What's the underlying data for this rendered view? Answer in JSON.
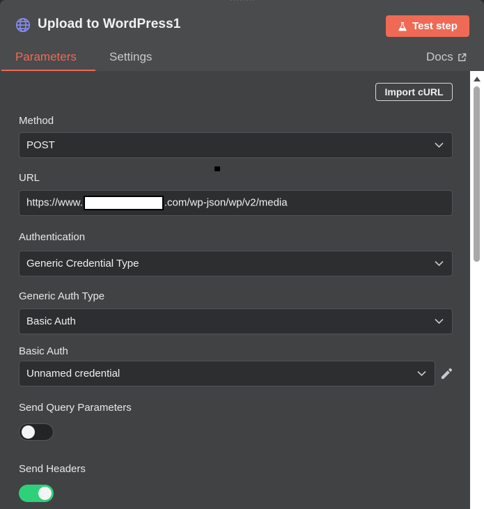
{
  "header": {
    "title": "Upload to WordPress1",
    "node_icon": "globe-icon",
    "test_step_label": "Test step",
    "test_step_icon": "flask-icon"
  },
  "tabs": [
    {
      "label": "Parameters",
      "active": true
    },
    {
      "label": "Settings",
      "active": false
    }
  ],
  "docs": {
    "label": "Docs",
    "icon": "external-link-icon"
  },
  "import_curl_label": "Import cURL",
  "fields": {
    "method": {
      "label": "Method",
      "value": "POST"
    },
    "url": {
      "label": "URL",
      "prefix": "https://www.",
      "suffix": ".com/wp-json/wp/v2/media"
    },
    "authentication": {
      "label": "Authentication",
      "value": "Generic Credential Type"
    },
    "generic_auth_type": {
      "label": "Generic Auth Type",
      "value": "Basic Auth"
    },
    "basic_auth": {
      "label": "Basic Auth",
      "value": "Unnamed credential",
      "edit_icon": "pencil-icon"
    }
  },
  "toggles": {
    "send_query": {
      "label": "Send Query Parameters",
      "on": false
    },
    "send_headers": {
      "label": "Send Headers",
      "on": true
    }
  },
  "colors": {
    "accent": "#ee6a55",
    "toggle_on": "#2ed17a",
    "node_icon": "#8a8cf5"
  }
}
